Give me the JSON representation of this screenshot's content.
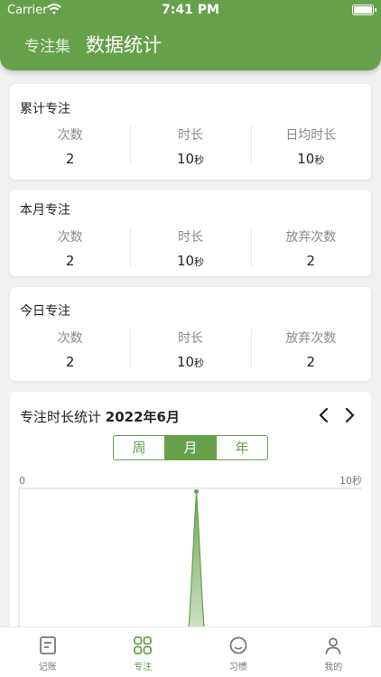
{
  "status": {
    "carrier": "Carrier",
    "time": "7:41 PM"
  },
  "nav": {
    "back_label": "专注集",
    "title": "数据统计"
  },
  "cards": [
    {
      "title": "累计专注",
      "stats": [
        {
          "label": "次数",
          "value": "2",
          "unit": ""
        },
        {
          "label": "时长",
          "value": "10",
          "unit": "秒"
        },
        {
          "label": "日均时长",
          "value": "10",
          "unit": "秒"
        }
      ]
    },
    {
      "title": "本月专注",
      "stats": [
        {
          "label": "次数",
          "value": "2",
          "unit": ""
        },
        {
          "label": "时长",
          "value": "10",
          "unit": "秒"
        },
        {
          "label": "放弃次数",
          "value": "2",
          "unit": ""
        }
      ]
    },
    {
      "title": "今日专注",
      "stats": [
        {
          "label": "次数",
          "value": "2",
          "unit": ""
        },
        {
          "label": "时长",
          "value": "10",
          "unit": "秒"
        },
        {
          "label": "放弃次数",
          "value": "2",
          "unit": ""
        }
      ]
    }
  ],
  "chart": {
    "title": "专注时长统计",
    "period": "2022年6月",
    "segments": [
      "周",
      "月",
      "年"
    ],
    "selected_segment": "月",
    "axis_min_label": "0",
    "axis_max_label": "10秒",
    "peak_day": 16,
    "peak_value_seconds": 10,
    "days_in_month": 30
  },
  "tabs": [
    {
      "label": "记账",
      "icon": "ledger-icon",
      "active": false
    },
    {
      "label": "专注",
      "icon": "grid-icon",
      "active": true
    },
    {
      "label": "习惯",
      "icon": "smile-icon",
      "active": false
    },
    {
      "label": "我的",
      "icon": "person-icon",
      "active": false
    }
  ],
  "colors": {
    "accent": "#67a04a",
    "background": "#f1f1f1",
    "card": "#ffffff"
  }
}
